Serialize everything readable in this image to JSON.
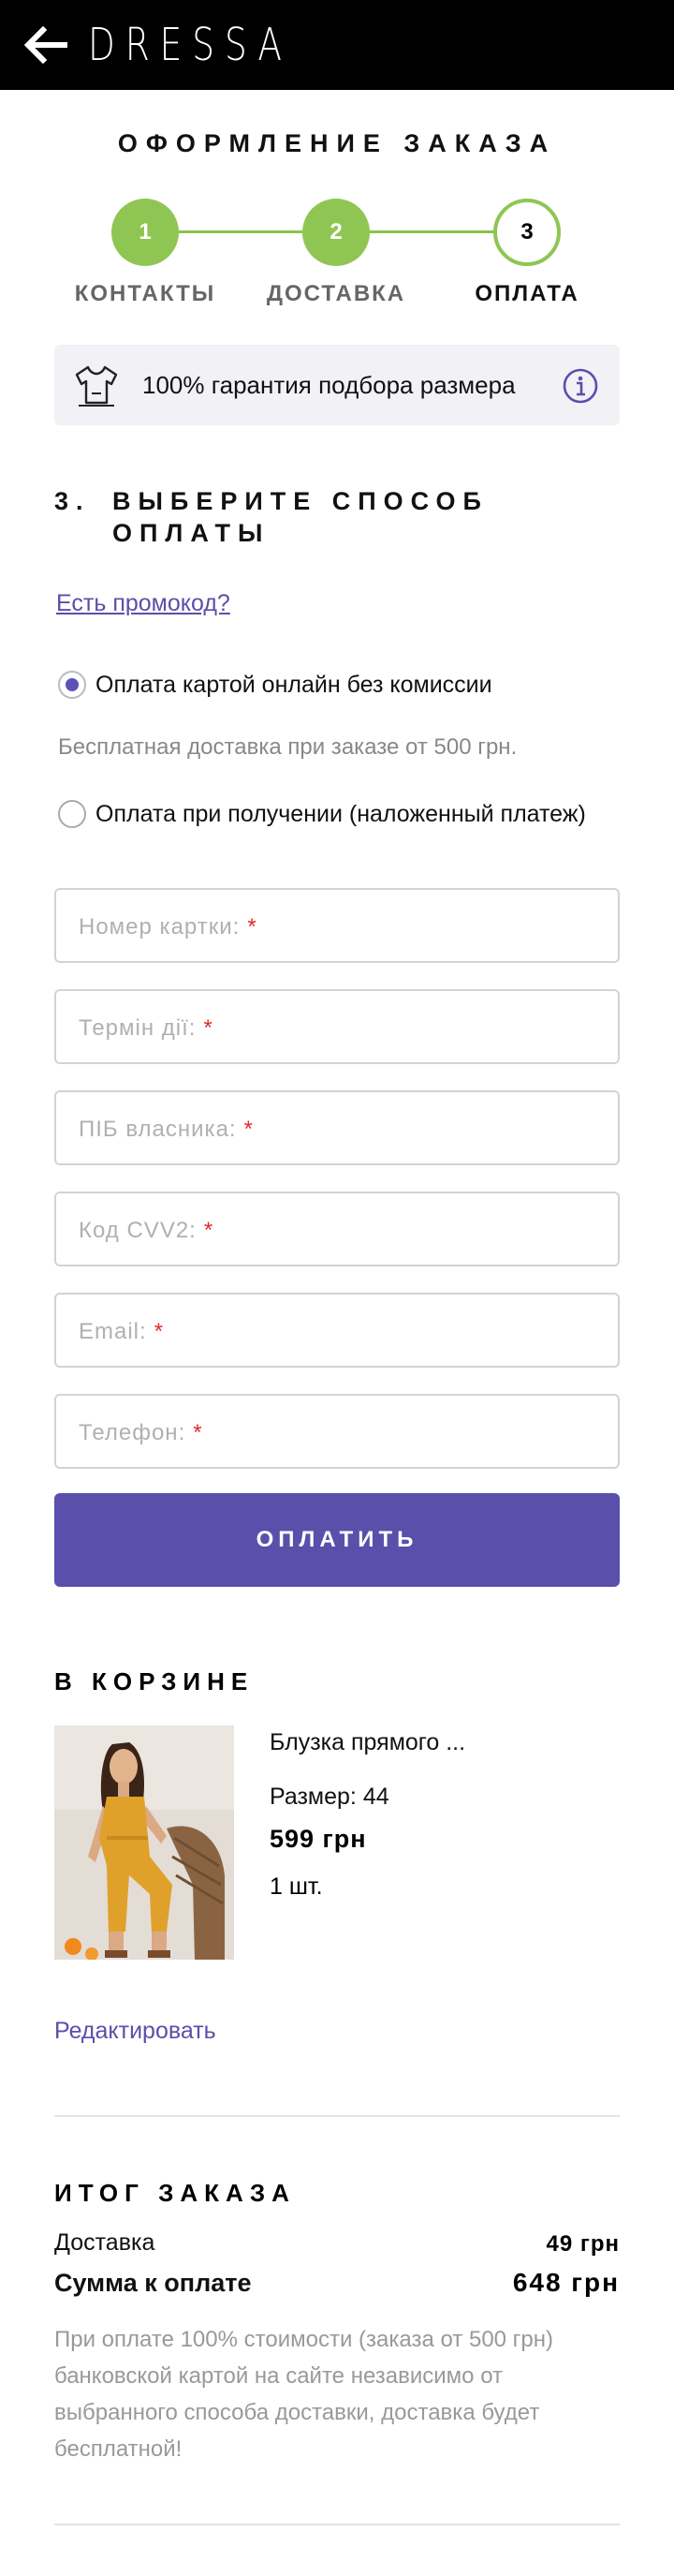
{
  "header": {
    "logo": "DRESSA",
    "back_icon": "arrow-left-icon"
  },
  "page_title": "ОФОРМЛЕНИЕ ЗАКАЗА",
  "steps": [
    {
      "number": "1",
      "label": "КОНТАКТЫ",
      "state": "done"
    },
    {
      "number": "2",
      "label": "ДОСТАВКА",
      "state": "done"
    },
    {
      "number": "3",
      "label": "ОПЛАТА",
      "state": "active"
    }
  ],
  "guarantee": {
    "text": "100% гарантия подбора размера",
    "icon": "tshirt-icon",
    "info_icon": "info-icon"
  },
  "payment": {
    "step_number": "3.",
    "title_line1": "ВЫБЕРИТЕ СПОСОБ",
    "title_line2": "ОПЛАТЫ",
    "promo_link": "Есть промокод?",
    "options": [
      {
        "label": "Оплата картой онлайн без комиссии",
        "selected": true
      },
      {
        "label": "Оплата при получении (наложенный платеж)",
        "selected": false
      }
    ],
    "note": "Бесплатная доставка при заказе от 500 грн.",
    "fields": [
      {
        "placeholder": "Номер картки:",
        "required_mark": "*"
      },
      {
        "placeholder": "Термін дії:",
        "required_mark": "*"
      },
      {
        "placeholder": "ПІБ власника:",
        "required_mark": "*"
      },
      {
        "placeholder": "Код CVV2:",
        "required_mark": "*"
      },
      {
        "placeholder": "Email:",
        "required_mark": "*"
      },
      {
        "placeholder": "Телефон:",
        "required_mark": "*"
      }
    ],
    "pay_button": "ОПЛАТИТЬ"
  },
  "cart": {
    "title": "В КОРЗИНЕ",
    "item": {
      "name": "Блузка прямого ...",
      "size": "Размер: 44",
      "price": "599 грн",
      "quantity": "1 шт."
    },
    "edit_link": "Редактировать"
  },
  "summary": {
    "title": "ИТОГ ЗАКАЗА",
    "delivery_label": "Доставка",
    "delivery_value": "49 грн",
    "total_label": "Сумма к оплате",
    "total_value": "648 грн",
    "disclaimer": "При оплате 100% стоимости (заказа от 500 грн) банковской картой на сайте независимо от выбранного способа доставки, доставка будет бесплатной!"
  },
  "colors": {
    "accent": "#5a4fab",
    "step_green": "#8fc653",
    "required": "#e22a2a"
  }
}
